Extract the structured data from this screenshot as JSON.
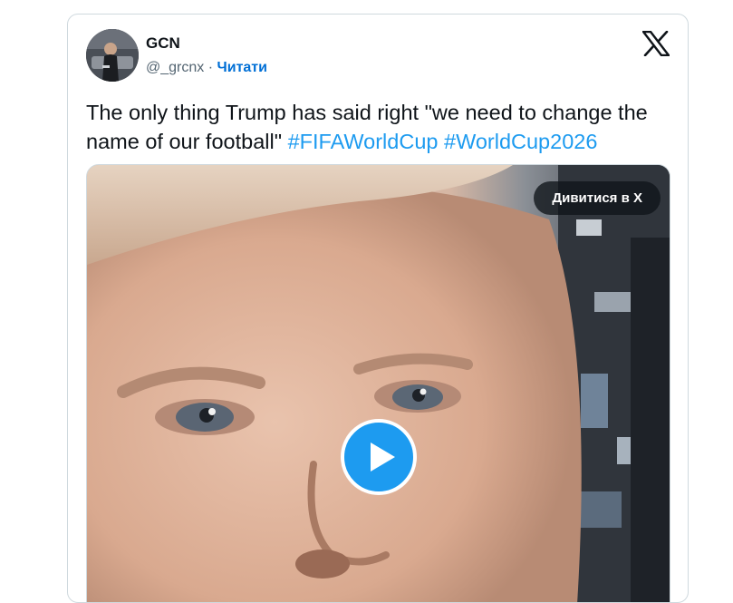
{
  "tweet": {
    "author_name": "GCN",
    "author_handle": "@_grcnx",
    "separator": " · ",
    "follow_label": "Читати",
    "text_plain": "The only thing Trump has said right \"we need to change the name of our football\" ",
    "hashtags": [
      "#FIFAWorldCup",
      "#WorldCup2026"
    ],
    "watch_label": "Дивитися в X"
  },
  "icons": {
    "brand": "x-logo-icon",
    "play": "play-icon"
  },
  "colors": {
    "link": "#1d9bf0",
    "follow": "#006fd6",
    "text": "#0f1419",
    "muted": "#536471",
    "border": "#cfd9de"
  }
}
